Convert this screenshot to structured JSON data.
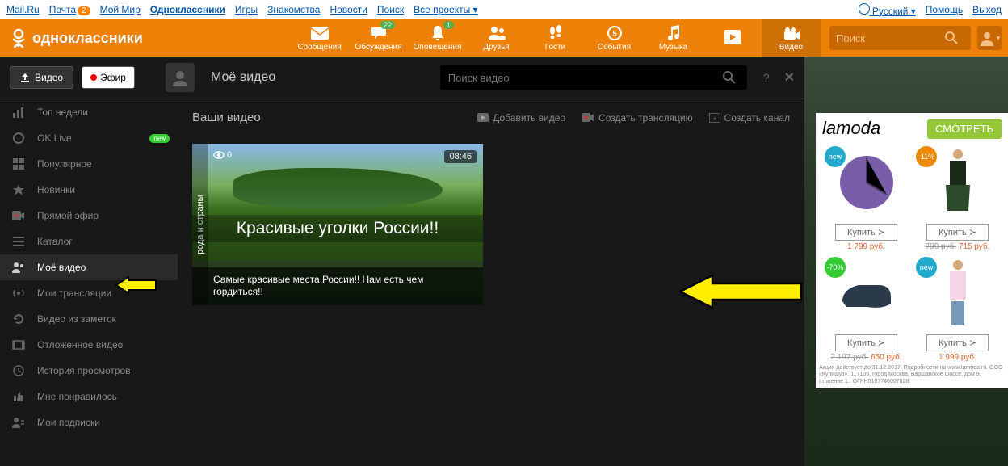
{
  "topbar": {
    "mailru": "Mail.Ru",
    "pochta": "Почта",
    "pochta_badge": "2",
    "moimir": "Мой Мир",
    "ok": "Одноклассники",
    "igry": "Игры",
    "znakomstva": "Знакомства",
    "novosti": "Новости",
    "poisk": "Поиск",
    "vse": "Все проекты",
    "lang": "Русский",
    "help": "Помощь",
    "exit": "Выход"
  },
  "header": {
    "logo": "одноклассники",
    "nav": {
      "msg": "Сообщения",
      "disc": "Обсуждения",
      "disc_badge": "22",
      "notif": "Оповещения",
      "notif_badge": "1",
      "friends": "Друзья",
      "guests": "Гости",
      "events": "События",
      "music": "Музыка",
      "video": "Видео"
    },
    "search_ph": "Поиск"
  },
  "btns": {
    "video": "Видео",
    "live": "Эфир"
  },
  "vtitle": "Моё видео",
  "vsearch_ph": "Поиск видео",
  "sidebar": {
    "top": "Топ недели",
    "oklive": "OK Live",
    "oklive_tag": "new",
    "popular": "Популярное",
    "new": "Новинки",
    "live": "Прямой эфир",
    "catalog": "Каталог",
    "myvideo": "Моё видео",
    "mystreams": "Мои трансляции",
    "fromnotes": "Видео из заметок",
    "delayed": "Отложенное видео",
    "history": "История просмотров",
    "liked": "Мне понравилось",
    "subs": "Мои подписки"
  },
  "content": {
    "title": "Ваши видео",
    "add": "Добавить видео",
    "stream": "Создать трансляцию",
    "channel": "Создать канал"
  },
  "card": {
    "side": "рода и страны",
    "views": "0",
    "duration": "08:46",
    "overlay": "Красивые уголки России!!",
    "caption": "Самые красивые места России!! Нам есть чем гордиться!!"
  },
  "ad": {
    "logo": "lamoda",
    "btn": "СМОТРЕТЬ",
    "new": "new",
    "d11": "-11%",
    "d70": "-70%",
    "buy": "Купить  ≻",
    "p1": "1 799 руб.",
    "p2_old": "799 руб.",
    "p2": "715 руб.",
    "p3_old": "2 197 руб.",
    "p3": "650 руб.",
    "p4": "1 999 руб.",
    "disclaimer": "Акция действует до 31.12.2017. Подробности на www.lamoda.ru. ООО «Купишуз». 117105, город Москва, Варшавское шоссе, дом 9, строение 1.. ОГРН5107746007628"
  }
}
